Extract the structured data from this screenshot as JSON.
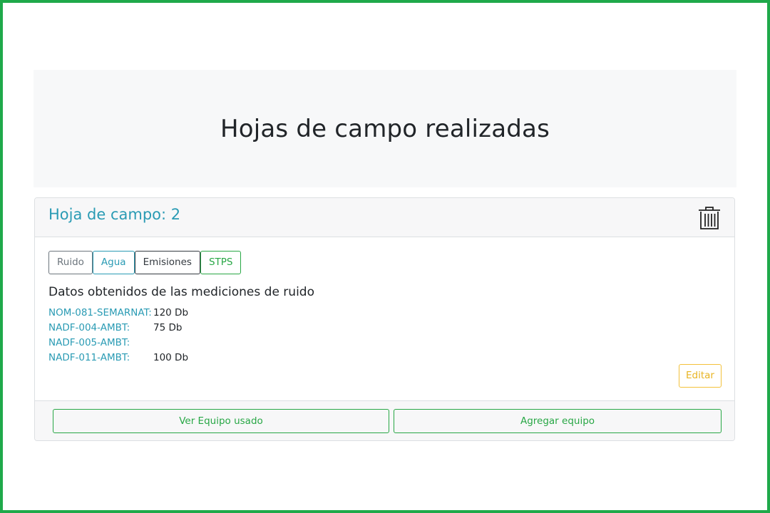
{
  "page": {
    "title": "Hojas de campo realizadas"
  },
  "card": {
    "header_title": "Hoja de campo: 2",
    "tabs": [
      {
        "label": "Ruido"
      },
      {
        "label": "Agua"
      },
      {
        "label": "Emisiones"
      },
      {
        "label": "STPS"
      }
    ],
    "section_title": "Datos obtenidos de las mediciones de ruido",
    "measurements": [
      {
        "label": "NOM-081-SEMARNAT:",
        "value": "120 Db"
      },
      {
        "label": "NADF-004-AMBT:",
        "value": "75 Db"
      },
      {
        "label": "NADF-005-AMBT:",
        "value": ""
      },
      {
        "label": "NADF-011-AMBT:",
        "value": "100 Db"
      }
    ],
    "edit_label": "Editar",
    "footer": {
      "ver_label": "Ver Equipo usado",
      "agregar_label": "Agregar equipo"
    },
    "icons": {
      "delete": "trash-icon"
    }
  },
  "colors": {
    "frame_border": "#1fa94a",
    "info": "#2a9bb4",
    "success": "#28a745",
    "warning": "#f3c13a",
    "secondary": "#6c757d",
    "dark": "#343a40"
  }
}
